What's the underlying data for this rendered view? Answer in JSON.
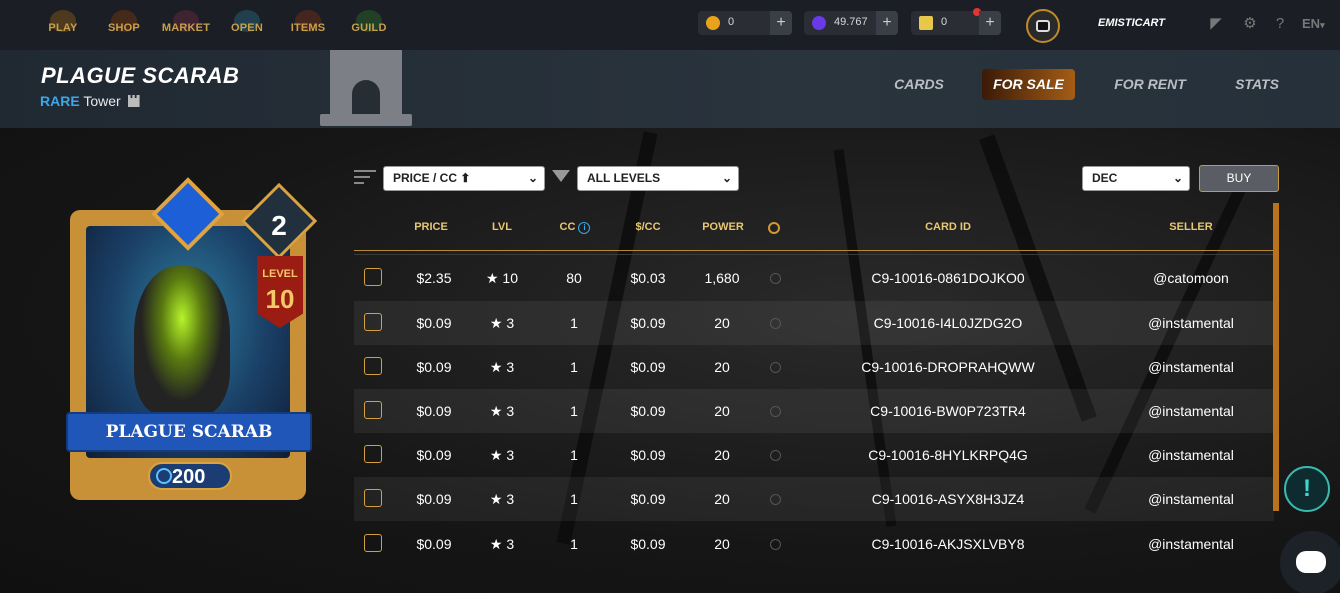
{
  "nav": {
    "items": [
      {
        "label": "PLAY",
        "color": "#8a5a18"
      },
      {
        "label": "SHOP",
        "color": "#7a3a10"
      },
      {
        "label": "MARKET",
        "color": "#6a2a40"
      },
      {
        "label": "OPEN",
        "color": "#2a6a80"
      },
      {
        "label": "ITEMS",
        "color": "#7a3018"
      },
      {
        "label": "GUILD",
        "color": "#2a6a2a"
      }
    ]
  },
  "currencies": [
    {
      "value": "0",
      "icon": "coin-icon",
      "color": "#e8a21c"
    },
    {
      "value": "49.767",
      "icon": "gem-icon",
      "color": "#6a3ae8"
    },
    {
      "value": "0",
      "icon": "ticket-icon",
      "color": "#e8c84a"
    }
  ],
  "user": {
    "name": "EMISTICART",
    "language": "EN"
  },
  "card": {
    "name": "PLAGUE SCARAB",
    "rarity": "RARE",
    "type": "Tower",
    "level_badge": "2",
    "level_word": "LEVEL",
    "level_num": "10",
    "power": "200"
  },
  "tabs": [
    {
      "label": "CARDS",
      "active": false
    },
    {
      "label": "FOR SALE",
      "active": true
    },
    {
      "label": "FOR RENT",
      "active": false
    },
    {
      "label": "STATS",
      "active": false
    }
  ],
  "filters": {
    "sort": "PRICE / CC ⬆",
    "levels": "ALL LEVELS",
    "order": "DEC",
    "buy_label": "BUY"
  },
  "table": {
    "headers": {
      "price": "PRICE",
      "lvl": "LVL",
      "cc": "CC",
      "cc_info": "i",
      "per_cc": "$/CC",
      "power": "POWER",
      "card_id": "CARD ID",
      "seller": "SELLER"
    },
    "rows": [
      {
        "price": "$2.35",
        "lvl": "★ 10",
        "cc": "80",
        "per_cc": "$0.03",
        "power": "1,680",
        "card_id": "C9-10016-0861DOJKO0",
        "seller": "@catomoon"
      },
      {
        "price": "$0.09",
        "lvl": "★ 3",
        "cc": "1",
        "per_cc": "$0.09",
        "power": "20",
        "card_id": "C9-10016-I4L0JZDG2O",
        "seller": "@instamental"
      },
      {
        "price": "$0.09",
        "lvl": "★ 3",
        "cc": "1",
        "per_cc": "$0.09",
        "power": "20",
        "card_id": "C9-10016-DROPRAHQWW",
        "seller": "@instamental"
      },
      {
        "price": "$0.09",
        "lvl": "★ 3",
        "cc": "1",
        "per_cc": "$0.09",
        "power": "20",
        "card_id": "C9-10016-BW0P723TR4",
        "seller": "@instamental"
      },
      {
        "price": "$0.09",
        "lvl": "★ 3",
        "cc": "1",
        "per_cc": "$0.09",
        "power": "20",
        "card_id": "C9-10016-8HYLKRPQ4G",
        "seller": "@instamental"
      },
      {
        "price": "$0.09",
        "lvl": "★ 3",
        "cc": "1",
        "per_cc": "$0.09",
        "power": "20",
        "card_id": "C9-10016-ASYX8H3JZ4",
        "seller": "@instamental"
      },
      {
        "price": "$0.09",
        "lvl": "★ 3",
        "cc": "1",
        "per_cc": "$0.09",
        "power": "20",
        "card_id": "C9-10016-AKJSXLVBY8",
        "seller": "@instamental"
      }
    ]
  },
  "widgets": {
    "help": "!"
  }
}
